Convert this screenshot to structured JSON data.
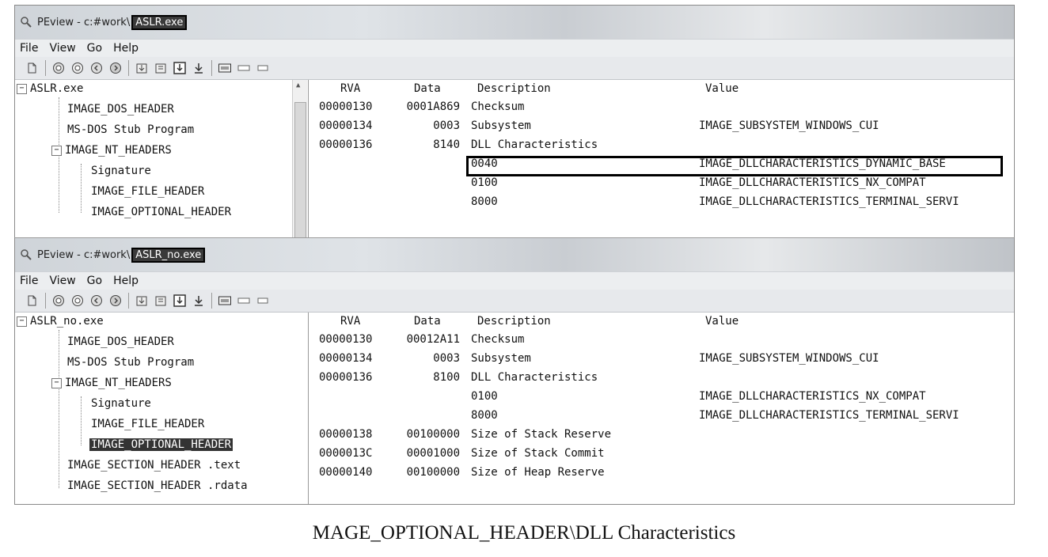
{
  "windows": [
    {
      "title_prefix": "PEview - c:#work\\",
      "title_file": "ASLR.exe",
      "menu": [
        "File",
        "View",
        "Go",
        "Help"
      ],
      "tree": [
        {
          "label": "ASLR.exe",
          "toggle": "−"
        },
        {
          "label": "IMAGE_DOS_HEADER"
        },
        {
          "label": "MS-DOS Stub Program"
        },
        {
          "label": "IMAGE_NT_HEADERS",
          "toggle": "−"
        },
        {
          "label": "Signature"
        },
        {
          "label": "IMAGE_FILE_HEADER"
        },
        {
          "label": "IMAGE_OPTIONAL_HEADER"
        }
      ],
      "columns": [
        "RVA",
        "Data",
        "Description",
        "Value"
      ],
      "rows": [
        {
          "rva": "00000130",
          "data": "0001A869",
          "desc": "Checksum",
          "value": ""
        },
        {
          "rva": "00000134",
          "data": "0003",
          "desc": "Subsystem",
          "value": "IMAGE_SUBSYSTEM_WINDOWS_CUI"
        },
        {
          "rva": "00000136",
          "data": "8140",
          "desc": "DLL Characteristics",
          "value": ""
        },
        {
          "rva": "",
          "data": "",
          "desc": "0040",
          "value": "IMAGE_DLLCHARACTERISTICS_DYNAMIC_BASE"
        },
        {
          "rva": "",
          "data": "",
          "desc": "0100",
          "value": "IMAGE_DLLCHARACTERISTICS_NX_COMPAT"
        },
        {
          "rva": "",
          "data": "",
          "desc": "8000",
          "value": "IMAGE_DLLCHARACTERISTICS_TERMINAL_SERVI"
        }
      ]
    },
    {
      "title_prefix": "PEview - c:#work\\",
      "title_file": "ASLR_no.exe",
      "menu": [
        "File",
        "View",
        "Go",
        "Help"
      ],
      "tree": [
        {
          "label": "ASLR_no.exe",
          "toggle": "−"
        },
        {
          "label": "IMAGE_DOS_HEADER"
        },
        {
          "label": "MS-DOS Stub Program"
        },
        {
          "label": "IMAGE_NT_HEADERS",
          "toggle": "−"
        },
        {
          "label": "Signature"
        },
        {
          "label": "IMAGE_FILE_HEADER"
        },
        {
          "label": "IMAGE_OPTIONAL_HEADER"
        },
        {
          "label": "IMAGE_SECTION_HEADER .text"
        },
        {
          "label": "IMAGE_SECTION_HEADER .rdata"
        }
      ],
      "columns": [
        "RVA",
        "Data",
        "Description",
        "Value"
      ],
      "rows": [
        {
          "rva": "00000130",
          "data": "00012A11",
          "desc": "Checksum",
          "value": ""
        },
        {
          "rva": "00000134",
          "data": "0003",
          "desc": "Subsystem",
          "value": "IMAGE_SUBSYSTEM_WINDOWS_CUI"
        },
        {
          "rva": "00000136",
          "data": "8100",
          "desc": "DLL Characteristics",
          "value": ""
        },
        {
          "rva": "",
          "data": "",
          "desc": "0100",
          "value": "IMAGE_DLLCHARACTERISTICS_NX_COMPAT"
        },
        {
          "rva": "",
          "data": "",
          "desc": "8000",
          "value": "IMAGE_DLLCHARACTERISTICS_TERMINAL_SERVI"
        },
        {
          "rva": "00000138",
          "data": "00100000",
          "desc": "Size of Stack Reserve",
          "value": ""
        },
        {
          "rva": "0000013C",
          "data": "00001000",
          "desc": "Size of Stack Commit",
          "value": ""
        },
        {
          "rva": "00000140",
          "data": "00100000",
          "desc": "Size of Heap Reserve",
          "value": ""
        }
      ]
    }
  ],
  "caption": "MAGE_OPTIONAL_HEADER\\DLL Characteristics"
}
